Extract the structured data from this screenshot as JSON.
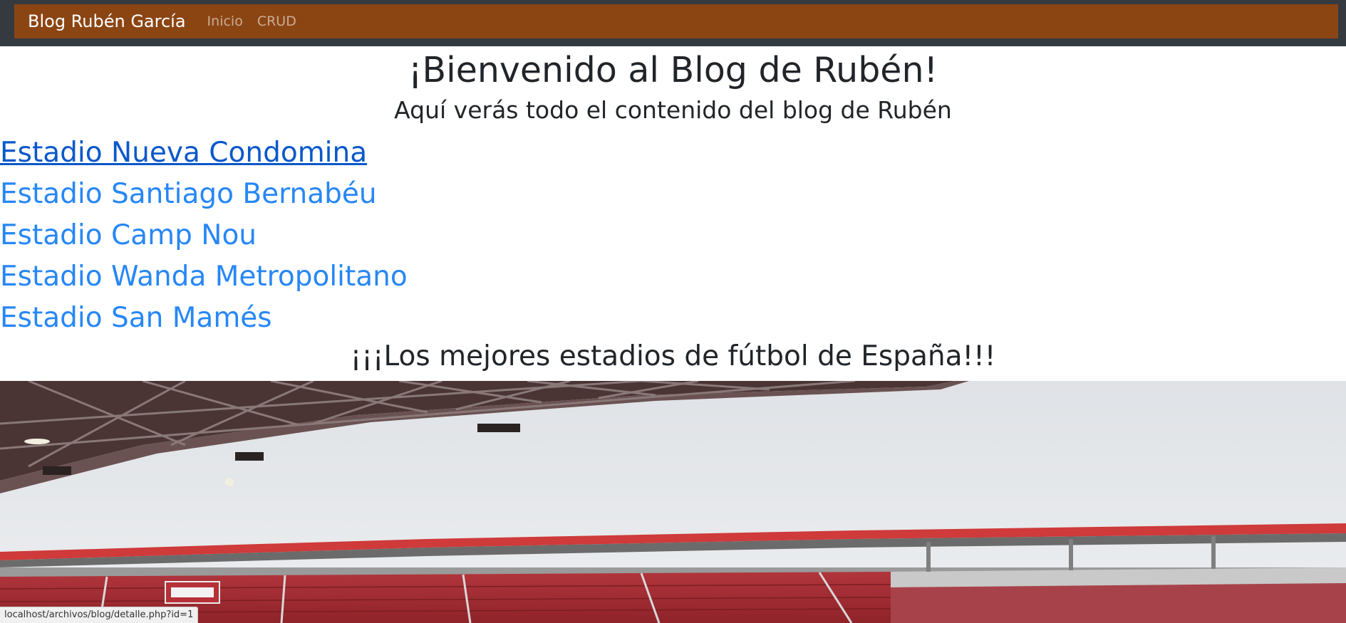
{
  "navbar": {
    "brand": "Blog Rubén García",
    "links": [
      "Inicio",
      "CRUD"
    ],
    "background_color": "#8b4513"
  },
  "main": {
    "title": "¡Bienvenido al Blog de Rubén!",
    "subtitle": "Aquí verás todo el contenido del blog de Rubén",
    "stadiums": [
      "Estadio Nueva Condomina",
      "Estadio Santiago Bernabéu",
      "Estadio Camp Nou",
      "Estadio Wanda Metropolitano",
      "Estadio San Mamés"
    ],
    "active_link": "Estadio Nueva Condomina",
    "tagline": "¡¡¡Los mejores estadios de fútbol de España!!!"
  },
  "status_bar": {
    "url": "localhost/archivos/blog/detalle.php?id=1"
  },
  "colors": {
    "link": "#2787f5",
    "link_active": "#0a58ca",
    "heading": "#212529"
  }
}
